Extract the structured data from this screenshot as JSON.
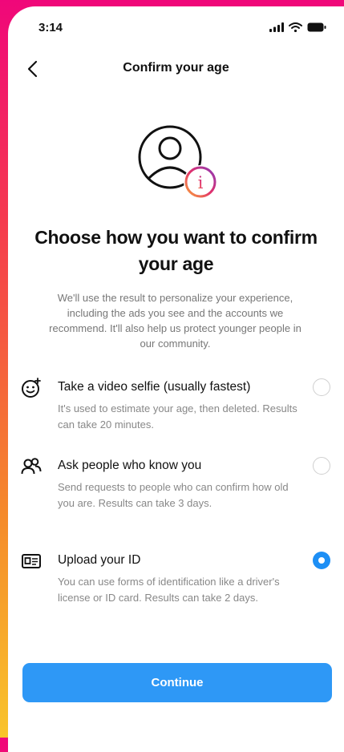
{
  "status_bar": {
    "time": "3:14"
  },
  "header": {
    "title": "Confirm your age"
  },
  "headline": "Choose how you want to confirm your age",
  "intro": "We'll use the result to personalize your experience, including the ads you see and the accounts we recommend. It'll also help us protect younger people in our community.",
  "options": [
    {
      "icon": "selfie-face-icon",
      "title": "Take a video selfie (usually fastest)",
      "description": "It's used to estimate your age, then deleted. Results can take 20 minutes.",
      "selected": false
    },
    {
      "icon": "people-icon",
      "title": "Ask people who know you",
      "description": "Send requests to people who can confirm how old you are. Results can take 3 days.",
      "selected": false
    },
    {
      "icon": "id-card-icon",
      "title": "Upload your ID",
      "description": "You can use forms of identification like a driver's license or ID card. Results can take 2 days.",
      "selected": true
    }
  ],
  "continue_label": "Continue",
  "colors": {
    "accent": "#2e98f6",
    "radio_selected": "#1d8ff5",
    "info_badge_gradient": [
      "#f9a23a",
      "#e1306c",
      "#8a3ab9"
    ]
  }
}
